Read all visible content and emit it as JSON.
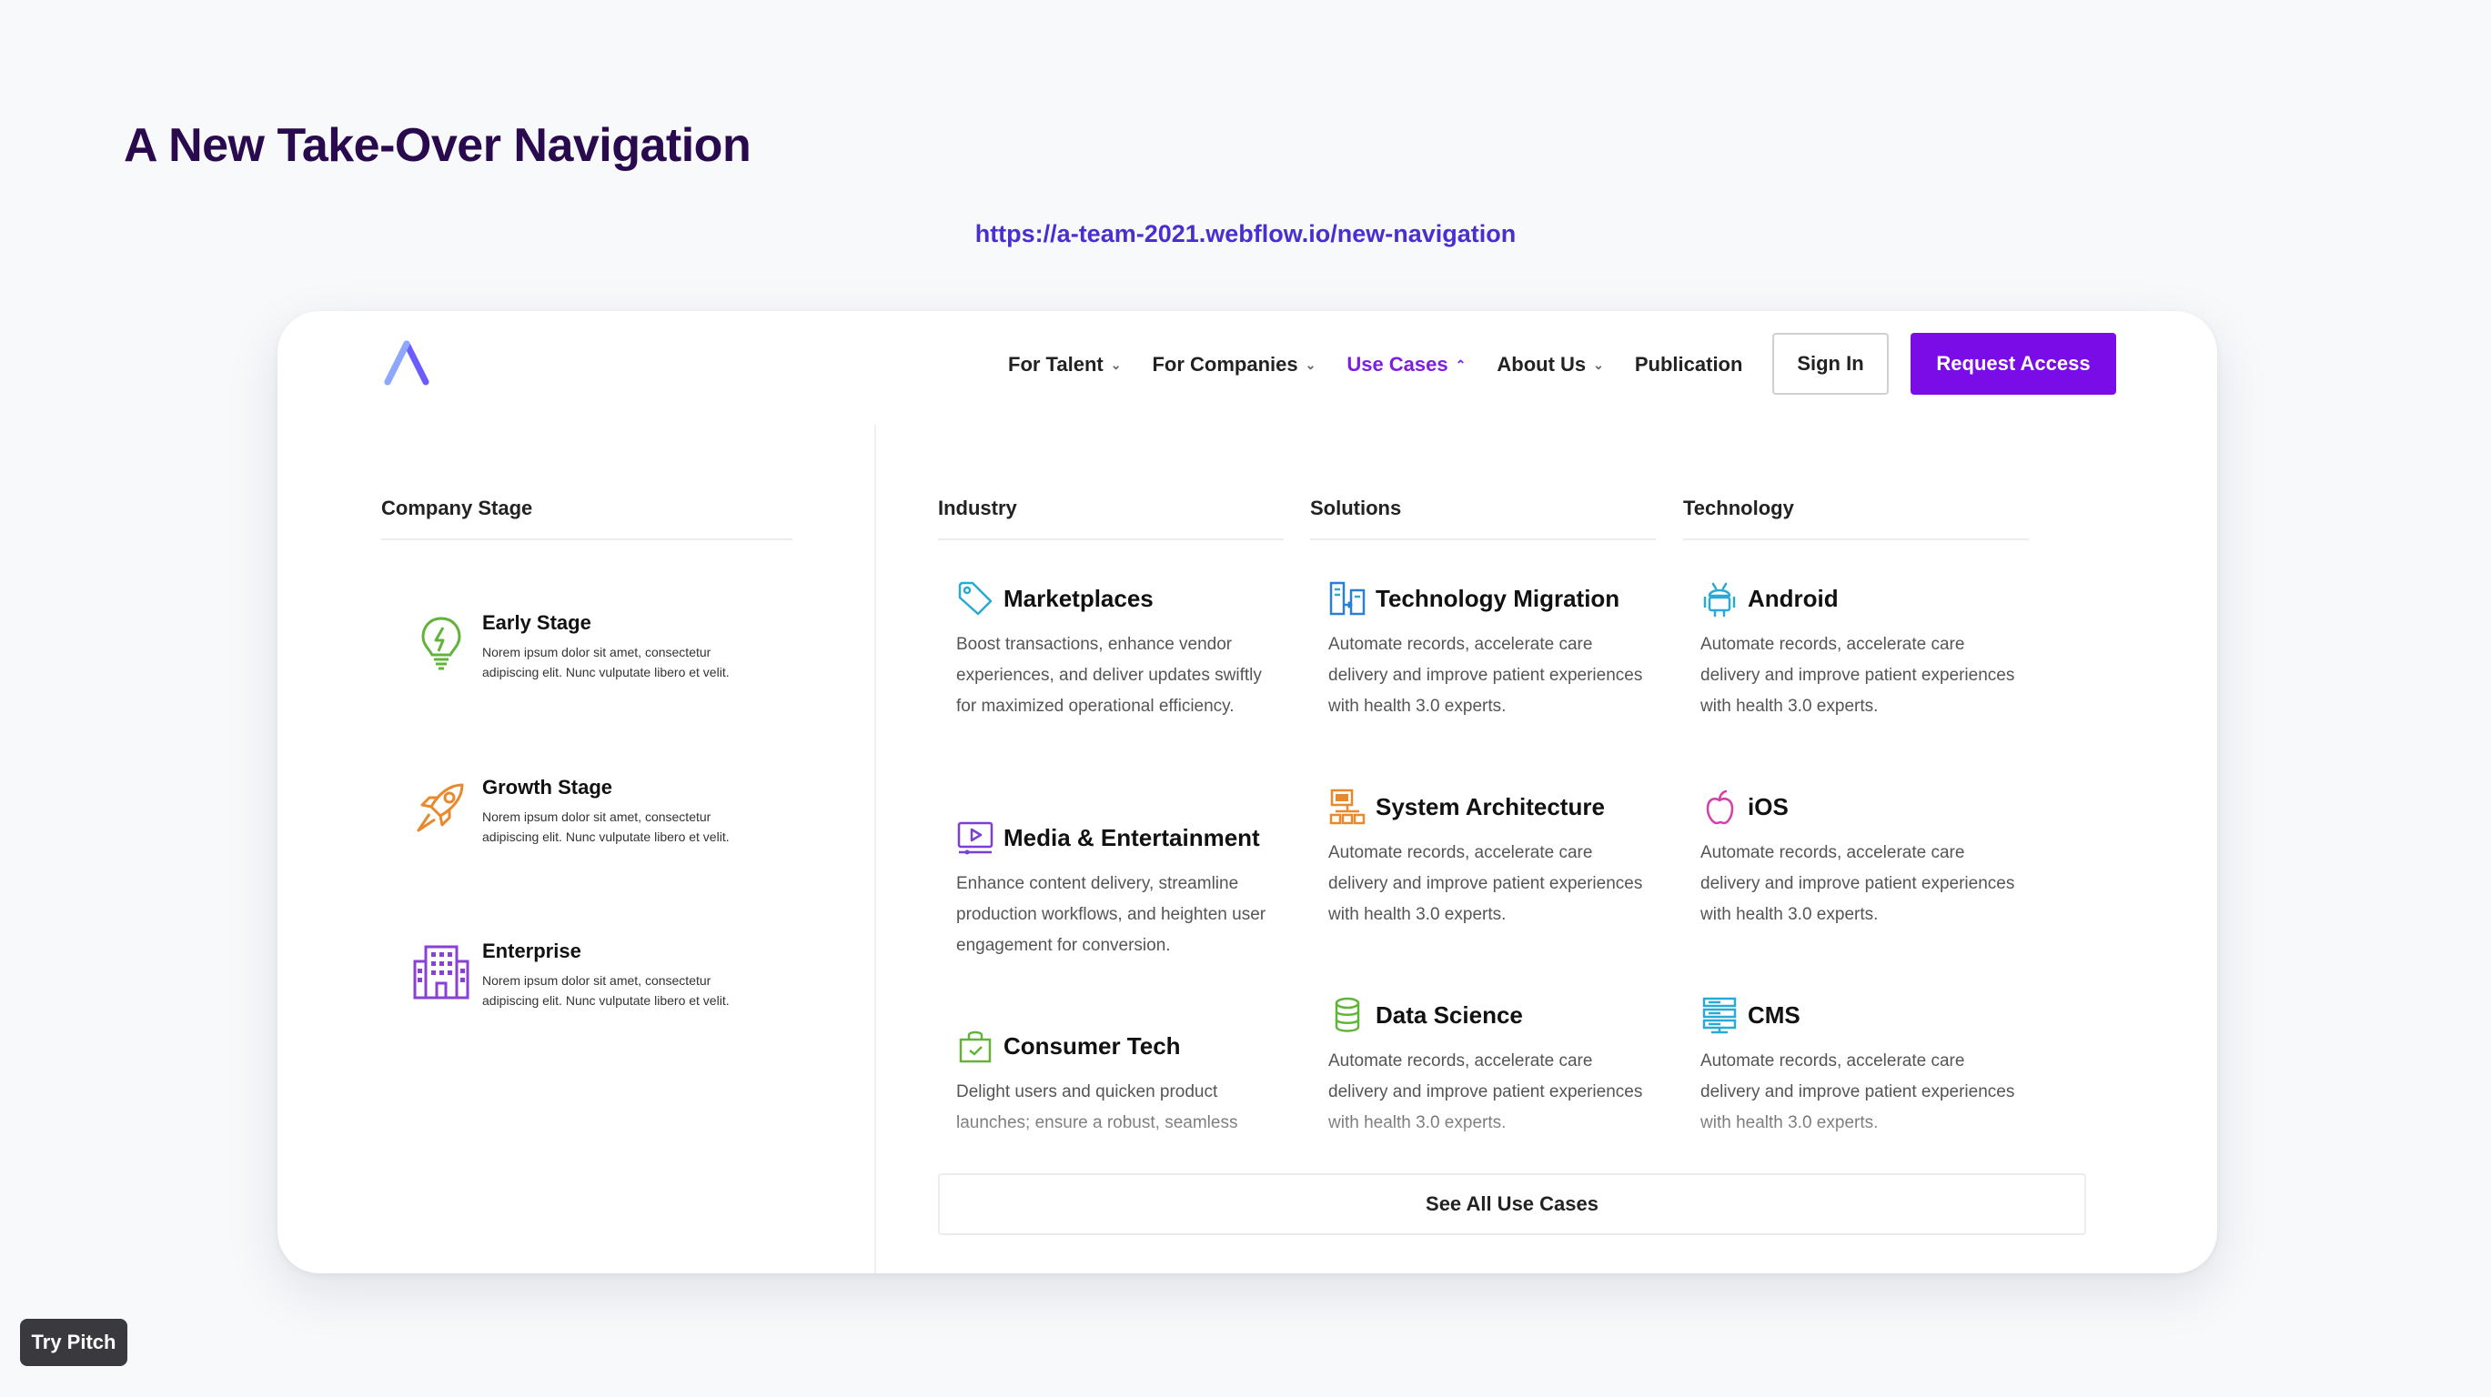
{
  "slide": {
    "title": "A New Take-Over Navigation",
    "url": "https://a-team-2021.webflow.io/new-navigation"
  },
  "nav": {
    "items": [
      {
        "label": "For Talent",
        "chevron": "⌄"
      },
      {
        "label": "For Companies",
        "chevron": "⌄"
      },
      {
        "label": "Use Cases",
        "chevron": "⌃",
        "active": true
      },
      {
        "label": "About Us",
        "chevron": "⌄"
      },
      {
        "label": "Publication"
      }
    ],
    "sign_in": "Sign In",
    "request_access": "Request Access"
  },
  "company_stage": {
    "title": "Company Stage",
    "items": [
      {
        "name": "Early Stage",
        "icon": "lightbulb-icon",
        "desc": "Norem ipsum dolor sit amet, consectetur adipiscing elit. Nunc vulputate libero et velit."
      },
      {
        "name": "Growth Stage",
        "icon": "rocket-icon",
        "desc": "Norem ipsum dolor sit amet, consectetur adipiscing elit. Nunc vulputate libero et velit."
      },
      {
        "name": "Enterprise",
        "icon": "building-icon",
        "desc": "Norem ipsum dolor sit amet, consectetur adipiscing elit. Nunc vulputate libero et velit."
      }
    ]
  },
  "industry": {
    "title": "Industry",
    "items": [
      {
        "name": "Marketplaces",
        "icon": "tag-icon",
        "desc": "Boost transactions, enhance vendor experiences, and deliver updates swiftly for maximized operational efficiency."
      },
      {
        "name": "Media & Entertainment",
        "icon": "play-screen-icon",
        "desc": "Enhance content delivery, streamline production workflows, and heighten user engagement for conversion."
      },
      {
        "name": "Consumer Tech",
        "icon": "shopping-bag-icon",
        "desc": "Delight users and quicken product launches; ensure a robust, seamless"
      }
    ]
  },
  "solutions": {
    "title": "Solutions",
    "items": [
      {
        "name": "Technology Migration",
        "icon": "migration-icon",
        "desc": "Automate records, accelerate care delivery and improve patient experiences with health 3.0 experts."
      },
      {
        "name": "System Architecture",
        "icon": "architecture-icon",
        "desc": "Automate records, accelerate care delivery and improve patient experiences with health 3.0 experts."
      },
      {
        "name": "Data Science",
        "icon": "database-icon",
        "desc": "Automate records, accelerate care delivery and improve patient experiences with health 3.0 experts."
      }
    ]
  },
  "technology": {
    "title": "Technology",
    "items": [
      {
        "name": "Android",
        "icon": "android-icon",
        "desc": "Automate records, accelerate care delivery and improve patient experiences with health 3.0 experts."
      },
      {
        "name": "iOS",
        "icon": "apple-icon",
        "desc": "Automate records, accelerate care delivery and improve patient experiences with health 3.0 experts."
      },
      {
        "name": "CMS",
        "icon": "cms-icon",
        "desc": "Automate records, accelerate care delivery and improve patient experiences with health 3.0 experts."
      }
    ]
  },
  "see_all": "See All Use Cases",
  "try_pitch": "Try Pitch",
  "colors": {
    "accent": "#7a0ce8",
    "title": "#2a0a4e",
    "url": "#4a2fd0"
  }
}
